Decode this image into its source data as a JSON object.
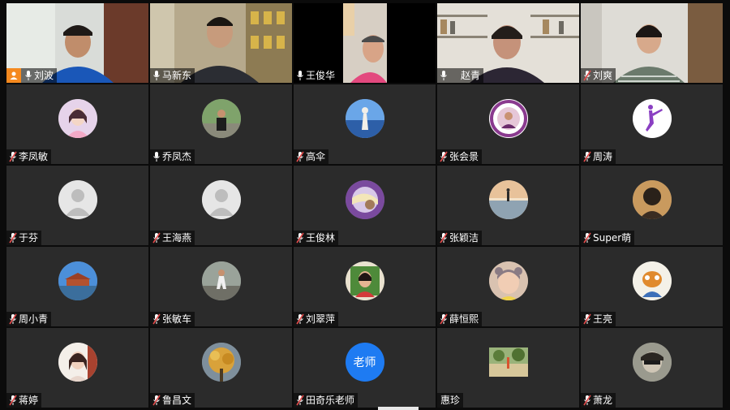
{
  "participants": [
    {
      "name": "刘波",
      "type": "video",
      "host": true,
      "mic": "on"
    },
    {
      "name": "马新东",
      "type": "video",
      "mic": "on"
    },
    {
      "name": "王俊华",
      "type": "video",
      "mic": "on"
    },
    {
      "name": "赵青",
      "type": "video",
      "mic": "on"
    },
    {
      "name": "刘爽",
      "type": "video",
      "mic": "muted"
    },
    {
      "name": "李凤敏",
      "type": "avatar",
      "mic": "muted"
    },
    {
      "name": "乔凤杰",
      "type": "avatar",
      "mic": "on"
    },
    {
      "name": "高伞",
      "type": "avatar",
      "mic": "muted"
    },
    {
      "name": "张会景",
      "type": "avatar",
      "mic": "muted"
    },
    {
      "name": "周涛",
      "type": "avatar",
      "mic": "muted"
    },
    {
      "name": "于芬",
      "type": "avatar",
      "mic": "muted"
    },
    {
      "name": "王海燕",
      "type": "avatar",
      "mic": "muted"
    },
    {
      "name": "王俊林",
      "type": "avatar",
      "mic": "muted"
    },
    {
      "name": "张颖洁",
      "type": "avatar",
      "mic": "muted"
    },
    {
      "name": "Super萌",
      "type": "avatar",
      "mic": "muted"
    },
    {
      "name": "周小青",
      "type": "avatar",
      "mic": "muted"
    },
    {
      "name": "张敏车",
      "type": "avatar",
      "mic": "muted"
    },
    {
      "name": "刘翠萍",
      "type": "avatar",
      "mic": "muted"
    },
    {
      "name": "薛恒熙",
      "type": "avatar",
      "mic": "muted"
    },
    {
      "name": "王亮",
      "type": "avatar",
      "mic": "muted"
    },
    {
      "name": "蒋婷",
      "type": "avatar",
      "mic": "muted"
    },
    {
      "name": "鲁昌文",
      "type": "avatar",
      "mic": "muted"
    },
    {
      "name": "田奇乐老师",
      "type": "text-avatar",
      "avatar_text": "老师",
      "mic": "muted"
    },
    {
      "name": "惠珍",
      "type": "avatar",
      "mic": "none"
    },
    {
      "name": "萧龙",
      "type": "avatar",
      "mic": "muted"
    }
  ],
  "colors": {
    "tile_bg": "#2b2b2b",
    "host_badge": "#f5891f",
    "text_avatar_bg": "#1e7bf2",
    "muted_mic": "#e34b4b"
  },
  "icons": {
    "mic_on": "microphone-icon",
    "mic_muted": "microphone-muted-icon",
    "host": "host-user-icon"
  }
}
